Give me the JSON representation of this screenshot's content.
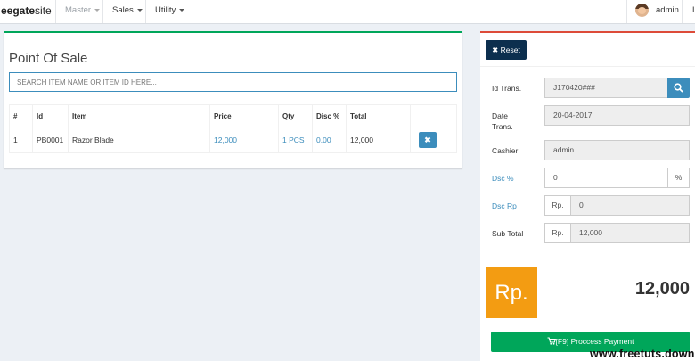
{
  "navbar": {
    "brand_bold": "eegate",
    "brand_rest": "site",
    "menu": [
      {
        "label": "Master"
      },
      {
        "label": "Sales"
      },
      {
        "label": "Utility"
      }
    ],
    "user_name": "admin",
    "edge_letter": "L"
  },
  "pos": {
    "title": "Point Of Sale",
    "search_placeholder": "SEARCH ITEM NAME OR ITEM ID HERE...",
    "columns": [
      "#",
      "Id",
      "Item",
      "Price",
      "Qty",
      "Disc %",
      "Total"
    ],
    "rows": [
      {
        "no": "1",
        "id": "PB0001",
        "item": "Razor Blade",
        "price": "12,000",
        "qty": "1 PCS",
        "disc": "0.00",
        "total": "12,000"
      }
    ]
  },
  "transaction": {
    "reset_label": "Reset",
    "id_label": "Id Trans.",
    "id_value": "J170420###",
    "date_label": "Date Trans.",
    "date_value": "20-04-2017",
    "cashier_label": "Cashier",
    "cashier_value": "admin",
    "dsc_pct_label": "Dsc %",
    "dsc_pct_value": "0",
    "dsc_pct_addon": "%",
    "dsc_rp_label": "Dsc Rp",
    "dsc_rp_addon": "Rp.",
    "dsc_rp_value": "0",
    "subtotal_label": "Sub Total",
    "subtotal_addon": "Rp.",
    "subtotal_value": "12,000",
    "currency_box": "Rp.",
    "grand_total": "12,000",
    "pay_label": "[F9] Proccess Payment"
  },
  "watermark": "www.freetuts.downloa",
  "colors": {
    "accent_blue": "#3c8dbc",
    "success_green": "#00a65a",
    "danger_red": "#dd4b39",
    "warning_orange": "#f39c12",
    "reset_navy": "#0c2f4e"
  }
}
